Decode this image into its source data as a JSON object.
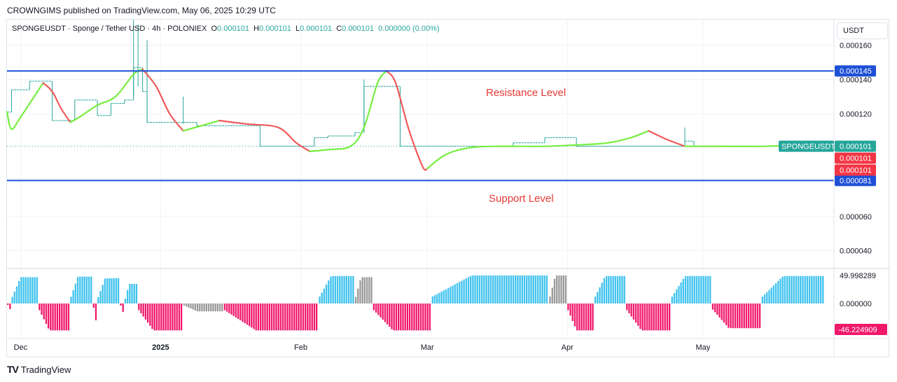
{
  "header": {
    "published": "CROWNGIMS published on TradingView.com, May 06, 2025 10:29 UTC"
  },
  "legend": {
    "symbol_text": "SPONGEUSDT · Sponge / Tether USD · 4h · POLONIEX",
    "o_label": "O",
    "o_value": "0.000101",
    "h_label": "H",
    "h_value": "0.000101",
    "l_label": "L",
    "l_value": "0.000101",
    "c_label": "C",
    "c_value": "0.000101",
    "change": "0.000000 (0.00%)"
  },
  "currency_button": "USDT",
  "annotations": {
    "resistance": "Resistance Level",
    "support": "Support Level"
  },
  "footer": {
    "brand": "TradingView",
    "logo": "TV"
  },
  "colors": {
    "level_line": "#1e50d7",
    "bull": "#26a69a",
    "ma_up": "#76ee3f",
    "ma_down": "#f05a5a",
    "hist_pos": "#3fc2ee",
    "hist_neg": "#f0186a",
    "hist_neutral": "#999999",
    "last_price": "#26a69a",
    "red_tag": "#f23645"
  },
  "chart_data": {
    "type": "line",
    "timeframe": "4h",
    "price_axis": {
      "ylim": [
        3e-05,
        0.000175
      ],
      "ticks": [
        "0.000160",
        "0.000140",
        "0.000120",
        "0.000060",
        "0.000040"
      ]
    },
    "x_axis": {
      "labels": [
        "Dec",
        "2025",
        "Feb",
        "Mar",
        "Apr",
        "May"
      ],
      "label_dates": [
        "2024-12-01",
        "2025-01-01",
        "2025-02-01",
        "2025-03-01",
        "2025-04-01",
        "2025-05-01"
      ],
      "range": [
        "2024-11-28",
        "2025-05-30"
      ]
    },
    "levels": [
      {
        "name": "Resistance Level",
        "price": 0.000145,
        "label": "0.000145"
      },
      {
        "name": "Support Level",
        "price": 8.1e-05,
        "label": "0.000081"
      }
    ],
    "price_tags": [
      {
        "label": "SPONGEUSDT",
        "value": "0.000101",
        "kind": "last"
      },
      {
        "value": "0.000101",
        "kind": "red"
      },
      {
        "value": "0.000101",
        "kind": "red"
      }
    ],
    "price_steps": [
      [
        "2024-11-28",
        0.000121
      ],
      [
        "2024-11-29",
        0.000134
      ],
      [
        "2024-12-03",
        0.000139
      ],
      [
        "2024-12-08",
        0.000116
      ],
      [
        "2024-12-13",
        0.000128
      ],
      [
        "2024-12-18",
        0.000119
      ],
      [
        "2024-12-21",
        0.000126
      ],
      [
        "2024-12-24",
        0.000128
      ],
      [
        "2024-12-26",
        0.000147
      ],
      [
        "2024-12-28",
        0.000133
      ],
      [
        "2024-12-29",
        0.000115
      ],
      [
        "2025-01-03",
        0.000115
      ],
      [
        "2025-01-09",
        0.000113
      ],
      [
        "2025-01-23",
        0.000101
      ],
      [
        "2025-02-04",
        0.000106
      ],
      [
        "2025-02-07",
        0.000107
      ],
      [
        "2025-02-13",
        0.000109
      ],
      [
        "2025-02-15",
        0.000136
      ],
      [
        "2025-02-23",
        0.000101
      ],
      [
        "2025-03-07",
        0.000101
      ],
      [
        "2025-03-20",
        0.000103
      ],
      [
        "2025-03-27",
        0.000106
      ],
      [
        "2025-04-03",
        0.000101
      ],
      [
        "2025-04-27",
        0.000104
      ],
      [
        "2025-04-29",
        0.000101
      ],
      [
        "2025-05-10",
        0.000101
      ]
    ],
    "wicks": [
      {
        "date": "2024-12-26",
        "high": 0.000175,
        "low": 0.00013
      },
      {
        "date": "2024-12-27",
        "high": 0.000172,
        "low": 0.000136
      },
      {
        "date": "2024-12-29",
        "high": 0.000163,
        "low": 0.000115
      },
      {
        "date": "2025-01-06",
        "high": 0.00013,
        "low": 0.000114
      },
      {
        "date": "2025-02-15",
        "high": 0.00014,
        "low": 0.000109
      },
      {
        "date": "2025-04-27",
        "high": 0.000112,
        "low": 0.000101
      }
    ],
    "ma_points": [
      [
        "2024-11-28",
        0.000121
      ],
      [
        "2024-11-29",
        0.000111
      ],
      [
        "2024-12-01",
        0.000118
      ],
      [
        "2024-12-05",
        0.000134
      ],
      [
        "2024-12-06",
        0.000138
      ],
      [
        "2024-12-08",
        0.000133
      ],
      [
        "2024-12-10",
        0.000123
      ],
      [
        "2024-12-12",
        0.000115
      ],
      [
        "2024-12-14",
        0.000118
      ],
      [
        "2024-12-18",
        0.000125
      ],
      [
        "2024-12-22",
        0.00013
      ],
      [
        "2024-12-26",
        0.000143
      ],
      [
        "2024-12-28",
        0.000146
      ],
      [
        "2024-12-31",
        0.000136
      ],
      [
        "2025-01-03",
        0.00012
      ],
      [
        "2025-01-06",
        0.00011
      ],
      [
        "2025-01-10",
        0.000113
      ],
      [
        "2025-01-14",
        0.000116
      ],
      [
        "2025-01-20",
        0.000114
      ],
      [
        "2025-01-27",
        0.000112
      ],
      [
        "2025-01-31",
        0.000103
      ],
      [
        "2025-02-03",
        9.8e-05
      ],
      [
        "2025-02-07",
        9.9e-05
      ],
      [
        "2025-02-12",
        0.000101
      ],
      [
        "2025-02-15",
        0.000112
      ],
      [
        "2025-02-18",
        0.000138
      ],
      [
        "2025-02-20",
        0.000145
      ],
      [
        "2025-02-22",
        0.000138
      ],
      [
        "2025-02-25",
        0.00011
      ],
      [
        "2025-02-28",
        8.9e-05
      ],
      [
        "2025-03-01",
        8.8e-05
      ],
      [
        "2025-03-05",
        9.6e-05
      ],
      [
        "2025-03-10",
        0.0001
      ],
      [
        "2025-03-16",
        0.000101
      ],
      [
        "2025-03-27",
        0.000101
      ],
      [
        "2025-04-05",
        0.000102
      ],
      [
        "2025-04-10",
        0.000103
      ],
      [
        "2025-04-15",
        0.000106
      ],
      [
        "2025-04-19",
        0.00011
      ],
      [
        "2025-04-23",
        0.000105
      ],
      [
        "2025-04-27",
        0.000101
      ],
      [
        "2025-05-02",
        0.000101
      ],
      [
        "2025-05-15",
        0.000101
      ],
      [
        "2025-05-22",
        0.000102
      ],
      [
        "2025-05-28",
        0.000101
      ]
    ],
    "ma_color_segments": [
      [
        "2024-11-28",
        "2024-12-06",
        "up"
      ],
      [
        "2024-12-06",
        "2024-12-12",
        "down"
      ],
      [
        "2024-12-12",
        "2024-12-28",
        "up"
      ],
      [
        "2024-12-28",
        "2025-01-06",
        "down"
      ],
      [
        "2025-01-06",
        "2025-01-14",
        "up"
      ],
      [
        "2025-01-14",
        "2025-02-03",
        "down"
      ],
      [
        "2025-02-03",
        "2025-02-20",
        "up"
      ],
      [
        "2025-02-20",
        "2025-03-01",
        "down"
      ],
      [
        "2025-03-01",
        "2025-04-19",
        "up"
      ],
      [
        "2025-04-19",
        "2025-04-27",
        "down"
      ],
      [
        "2025-04-27",
        "2025-05-28",
        "up"
      ]
    ],
    "oscillator": {
      "axis_labels": [
        "49.998289",
        "0.000000"
      ],
      "ylim": [
        -50,
        50
      ],
      "min_tag": "-46.224909",
      "segments": [
        [
          "2024-11-28",
          "2024-11-29",
          -10,
          "neg"
        ],
        [
          "2024-11-29",
          "2024-12-05",
          47,
          "pos"
        ],
        [
          "2024-12-05",
          "2024-12-12",
          -48,
          "neg"
        ],
        [
          "2024-12-12",
          "2024-12-17",
          48,
          "pos"
        ],
        [
          "2024-12-17",
          "2024-12-18",
          -30,
          "neg"
        ],
        [
          "2024-12-18",
          "2024-12-23",
          45,
          "pos"
        ],
        [
          "2024-12-23",
          "2024-12-24",
          -15,
          "neg"
        ],
        [
          "2024-12-24",
          "2024-12-27",
          35,
          "pos"
        ],
        [
          "2024-12-27",
          "2025-01-06",
          -48,
          "neg"
        ],
        [
          "2025-01-06",
          "2025-01-15",
          -14,
          "neutral"
        ],
        [
          "2025-01-15",
          "2025-02-05",
          -48,
          "neg"
        ],
        [
          "2025-02-05",
          "2025-02-13",
          49,
          "pos"
        ],
        [
          "2025-02-13",
          "2025-02-17",
          47,
          "neutral"
        ],
        [
          "2025-02-17",
          "2025-03-02",
          -48,
          "neg"
        ],
        [
          "2025-03-02",
          "2025-03-28",
          50,
          "pos"
        ],
        [
          "2025-03-28",
          "2025-04-01",
          50,
          "neutral"
        ],
        [
          "2025-04-01",
          "2025-04-07",
          -48,
          "neg"
        ],
        [
          "2025-04-07",
          "2025-04-14",
          49,
          "pos"
        ],
        [
          "2025-04-14",
          "2025-04-24",
          -48,
          "neg"
        ],
        [
          "2025-04-24",
          "2025-05-03",
          49,
          "pos"
        ],
        [
          "2025-05-03",
          "2025-05-14",
          -44,
          "neg"
        ],
        [
          "2025-05-14",
          "2025-05-28",
          49,
          "pos"
        ]
      ]
    }
  }
}
